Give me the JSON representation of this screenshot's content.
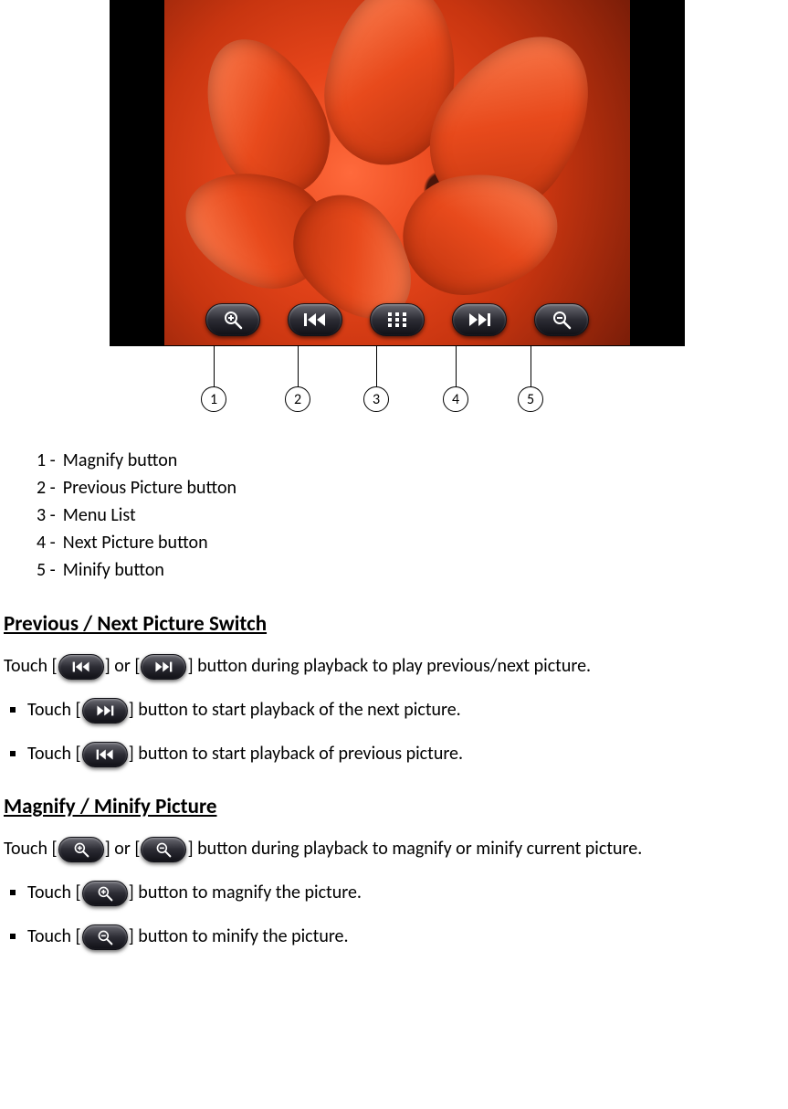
{
  "callouts": {
    "c1": "1",
    "c2": "2",
    "c3": "3",
    "c4": "4",
    "c5": "5"
  },
  "legend": {
    "n1": "1 -",
    "l1": "Magnify button",
    "n2": "2 -",
    "l2": "Previous Picture button",
    "n3": "3 -",
    "l3": "Menu List",
    "n4": "4 -",
    "l4": "Next Picture button",
    "n5": "5 -",
    "l5": "Minify button"
  },
  "section1": {
    "heading": "Previous / Next Picture Switch",
    "intro_a": "Touch [",
    "intro_b": "] or [",
    "intro_c": "] button during playback to play previous/next picture.",
    "b1a": "Touch [",
    "b1b": "] button to start playback of the next picture.",
    "b2a": "Touch [",
    "b2b": "] button to start playback of previous picture."
  },
  "section2": {
    "heading": "Magnify / Minify Picture",
    "intro_a": "Touch [",
    "intro_b": "] or [",
    "intro_c": "] button during playback to magnify or minify current picture.",
    "b1a": "Touch [",
    "b1b": "] button to magnify the picture.",
    "b2a": "Touch [",
    "b2b": "] button to minify the picture."
  }
}
